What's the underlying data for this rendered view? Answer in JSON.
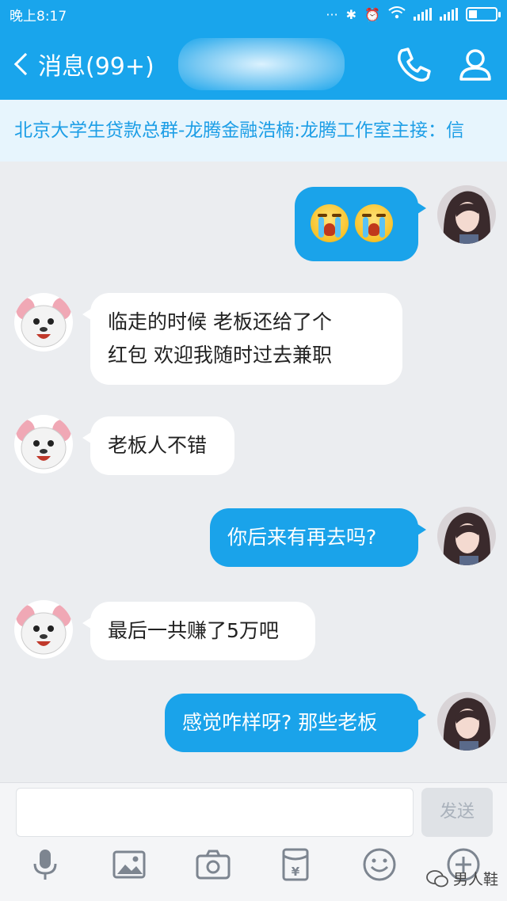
{
  "status_bar": {
    "time": "晚上8:17"
  },
  "nav": {
    "back_label": "消息(99+)",
    "icons": [
      "back-icon",
      "phone-icon",
      "person-icon"
    ]
  },
  "announcement": {
    "text": "北京大学生贷款总群-龙腾金融浩楠:龙腾工作室主接：信"
  },
  "messages": [
    {
      "direction": "out",
      "type": "emoji",
      "content": [
        "crying-face-emoji",
        "crying-face-emoji"
      ]
    },
    {
      "direction": "in",
      "lines": [
        "临走的时候  老板还给了个",
        "红包  欢迎我随时过去兼职"
      ]
    },
    {
      "direction": "in",
      "lines": [
        "老板人不错"
      ]
    },
    {
      "direction": "out",
      "lines": [
        "你后来有再去吗?"
      ]
    },
    {
      "direction": "in",
      "lines": [
        "最后一共赚了5万吧"
      ]
    },
    {
      "direction": "out",
      "lines": [
        "感觉咋样呀? 那些老板"
      ]
    }
  ],
  "input_bar": {
    "send_label": "发送",
    "input_value": "",
    "toolbar_icons": [
      "microphone-icon",
      "image-icon",
      "camera-icon",
      "red-packet-icon",
      "smiley-icon",
      "plus-icon"
    ]
  },
  "watermark": {
    "text": "男人鞋"
  },
  "colors": {
    "accent": "#19a5ec",
    "outgoing_bubble": "#1aa3ea",
    "incoming_bubble": "#ffffff",
    "background": "#ebedf0",
    "announcement_text": "#1d9ee6"
  }
}
